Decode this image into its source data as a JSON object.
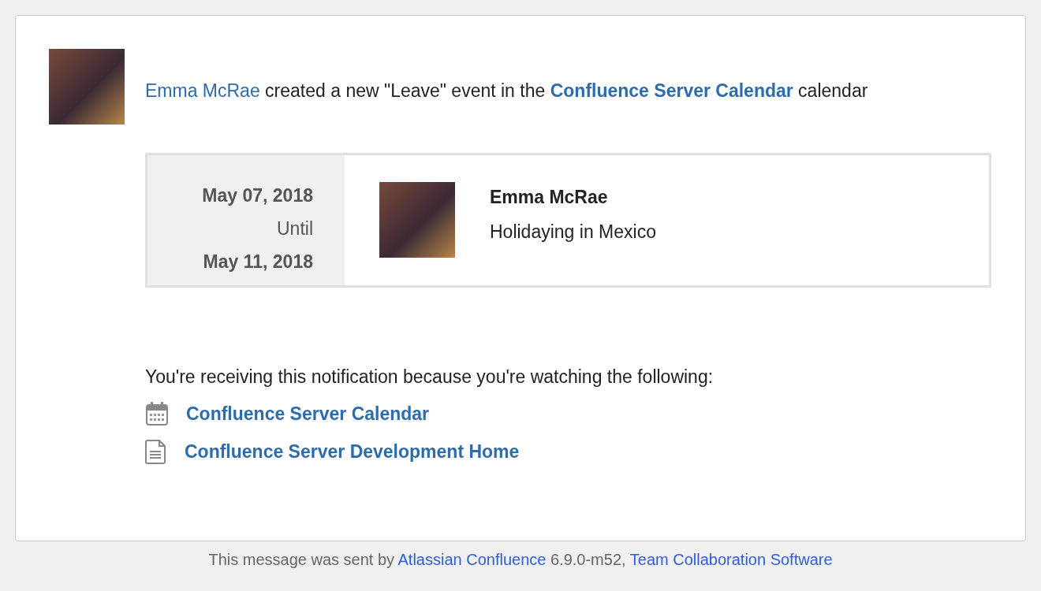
{
  "notification": {
    "actor": "Emma McRae",
    "action": "created a new \"Leave\" event in the",
    "calendar": "Confluence Server Calendar",
    "suffix": "calendar"
  },
  "event": {
    "start": "May 07, 2018",
    "until": "Until",
    "end": "May 11, 2018",
    "person": "Emma McRae",
    "description": "Holidaying in Mexico"
  },
  "watching": {
    "intro": "You're receiving this notification because you're watching the following:",
    "items": [
      {
        "kind": "calendar",
        "label": "Confluence Server Calendar"
      },
      {
        "kind": "page",
        "label": "Confluence Server Development Home"
      }
    ]
  },
  "footer": {
    "prefix": "This message was sent by",
    "product": "Atlassian Confluence",
    "version": "6.9.0-m52,",
    "tagline": "Team Collaboration Software"
  }
}
